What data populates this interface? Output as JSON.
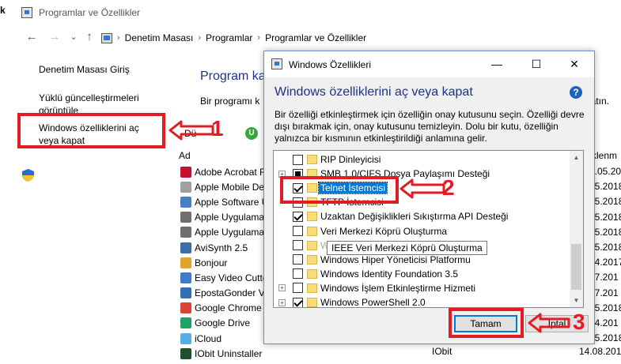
{
  "window": {
    "title": "Programlar ve Özellikler",
    "left_edge_char": "k"
  },
  "address_bar": {
    "back": "←",
    "forward": "→",
    "recent": "⌄",
    "up": "↑",
    "crumbs": [
      "Denetim Masası",
      "Programlar",
      "Programlar ve Özellikler"
    ],
    "sep": "›"
  },
  "sidebar": {
    "items": [
      {
        "label": "Denetim Masası Giriş"
      },
      {
        "label": "Yüklü güncelleştirmeleri görüntüle"
      },
      {
        "label": "Windows özelliklerini aç veya kapat"
      }
    ]
  },
  "main": {
    "title_fragment": "Program ka",
    "desc_fragment": "Bir programı k",
    "desc_end_fragment": "klatın.",
    "toolbar_fragment": "Dü",
    "uninstall_letter": "U",
    "column_name": "Ad",
    "column_right": "klenm",
    "programs": [
      {
        "name": "Adobe Acrobat R",
        "icon_color": "#c8102e",
        "right": "7.05.201"
      },
      {
        "name": "Apple Mobile De",
        "icon_color": "#a0a0a0",
        "right": "05.2018"
      },
      {
        "name": "Apple Software U",
        "icon_color": "#4a7fc8",
        "right": "05.2018"
      },
      {
        "name": "Apple Uygulama",
        "icon_color": "#6f6f6f",
        "right": "05.2018"
      },
      {
        "name": "Apple Uygulama",
        "icon_color": "#6f6f6f",
        "right": "05.2018"
      },
      {
        "name": "AviSynth 2.5",
        "icon_color": "#3a6ea5",
        "right": "05.2018"
      },
      {
        "name": "Bonjour",
        "icon_color": "#e3a32a",
        "right": "04.2017"
      },
      {
        "name": "Easy Video Cutte",
        "icon_color": "#3d7cc9",
        "right": "07.201"
      },
      {
        "name": "EpostaGonder V1",
        "icon_color": "#2f6fb5",
        "right": "07.201"
      },
      {
        "name": "Google Chrome",
        "icon_color": "#db4437",
        "right": "05.2018"
      },
      {
        "name": "Google Drive",
        "icon_color": "#1fa463",
        "right": "04.201"
      },
      {
        "name": "iCloud",
        "icon_color": "#5aaee8",
        "right": "05.2018"
      },
      {
        "name": "IObit Uninstaller",
        "icon_color": "#1f4e2a",
        "right": ""
      }
    ],
    "iobit_publisher": "IObit",
    "iobit_date": "14.08.201"
  },
  "dialog": {
    "title": "Windows Özellikleri",
    "minimize": "—",
    "maximize": "☐",
    "close": "✕",
    "heading": "Windows özelliklerini aç veya kapat",
    "help": "?",
    "description": "Bir özelliği etkinleştirmek için özelliğin onay kutusunu seçin. Özelliği devre dışı bırakmak için, onay kutusunu temizleyin. Dolu bir kutu, özelliğin yalnızca bir kısmının etkinleştirildiği anlamına gelir.",
    "features": [
      {
        "label": "RIP Dinleyicisi",
        "state": "unchecked",
        "expander": false,
        "faded": false,
        "selected": false
      },
      {
        "label": "SMB 1.0/CIFS Dosya Paylaşımı Desteği",
        "state": "partial",
        "expander": true,
        "faded": false,
        "selected": false
      },
      {
        "label": "Telnet İstemcisi",
        "state": "checked",
        "expander": false,
        "faded": false,
        "selected": true
      },
      {
        "label": "TFTP İstemcisi",
        "state": "unchecked",
        "expander": false,
        "faded": false,
        "selected": false
      },
      {
        "label": "Uzaktan Değişiklikleri Sıkıştırma API Desteği",
        "state": "checked",
        "expander": false,
        "faded": false,
        "selected": false
      },
      {
        "label": "Veri Merkezi Köprü Oluşturma",
        "state": "unchecked",
        "expander": false,
        "faded": false,
        "selected": false
      },
      {
        "label": "Windows",
        "state": "unchecked",
        "expander": false,
        "faded": true,
        "selected": false
      },
      {
        "label": "Windows Hiper Yöneticisi Platformu",
        "state": "unchecked",
        "expander": false,
        "faded": false,
        "selected": false
      },
      {
        "label": "Windows Identity Foundation 3.5",
        "state": "unchecked",
        "expander": false,
        "faded": false,
        "selected": false
      },
      {
        "label": "Windows İşlem Etkinleştirme Hizmeti",
        "state": "unchecked",
        "expander": true,
        "faded": false,
        "selected": false
      },
      {
        "label": "Windows PowerShell 2.0",
        "state": "checked",
        "expander": true,
        "faded": false,
        "selected": false
      }
    ],
    "tooltip": "IEEE Veri Merkezi Köprü Oluşturma",
    "ok_label": "Tamam",
    "cancel_label": "İptal"
  },
  "annotations": {
    "numbers": [
      "1",
      "2",
      "3"
    ],
    "color": "#e31b23"
  }
}
